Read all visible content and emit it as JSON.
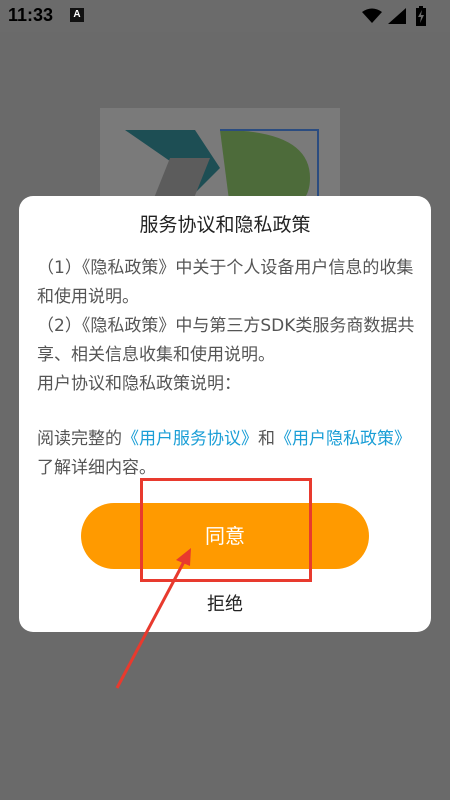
{
  "status_bar": {
    "time": "11:33",
    "indicator": "A",
    "icons": [
      "wifi-icon",
      "signal-icon",
      "battery-charging-icon"
    ]
  },
  "dialog": {
    "title": "服务协议和隐私政策",
    "item1": "（1）《隐私政策》中关于个人设备用户信息的收集和使用说明。",
    "item2": "（2）《隐私政策》中与第三方SDK类服务商数据共享、相关信息收集和使用说明。",
    "summary": "用户协议和隐私政策说明：",
    "read_prefix": "阅读完整的",
    "user_agreement_link": "《用户服务协议》",
    "and_text": "和",
    "privacy_link": "《用户隐私政策》",
    "read_suffix": "了解详细内容。",
    "agree_label": "同意",
    "refuse_label": "拒绝"
  },
  "colors": {
    "accent": "#ff9a00",
    "link": "#1a9ed6",
    "annotation": "#e83a2e",
    "overlay": "#6a6a6a"
  }
}
